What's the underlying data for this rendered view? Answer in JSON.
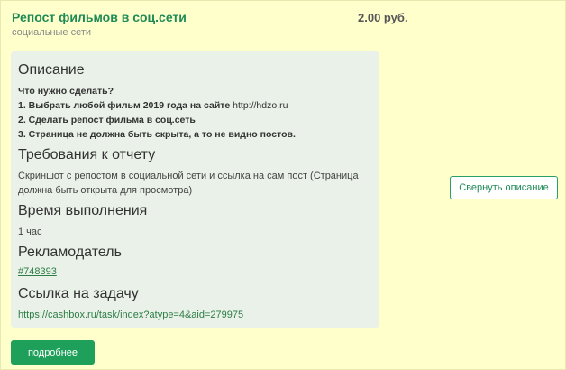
{
  "task": {
    "title": "Репост фильмов в соц.сети",
    "category": "социальные сети",
    "price": "2.00 руб."
  },
  "description": {
    "heading": "Описание",
    "intro": "Что нужно сделать?",
    "step1_bold": "1. Выбрать любой фильм 2019 года на сайте ",
    "step1_site": "http://hdzo.ru",
    "step2": "2. Сделать репост фильма в соц.сеть",
    "step3": "3. Страница не должна быть скрыта, а то не видно постов."
  },
  "report": {
    "heading": "Требования к отчету",
    "text": "Скриншот с репостом в социальной сети и ссылка на сам пост (Страница должна быть открыта для просмотра)"
  },
  "duration": {
    "heading": "Время выполнения",
    "value": "1 час"
  },
  "advertiser": {
    "heading": "Рекламодатель",
    "id": "#748393"
  },
  "task_link": {
    "heading": "Ссылка на задачу",
    "url": "https://cashbox.ru/task/index?atype=4&aid=279975"
  },
  "buttons": {
    "collapse": "Свернуть описание",
    "more": "подробнее"
  },
  "colors": {
    "card_bg": "#ffffcc",
    "panel_bg": "#e9f1e8",
    "accent": "#1fa05a"
  }
}
